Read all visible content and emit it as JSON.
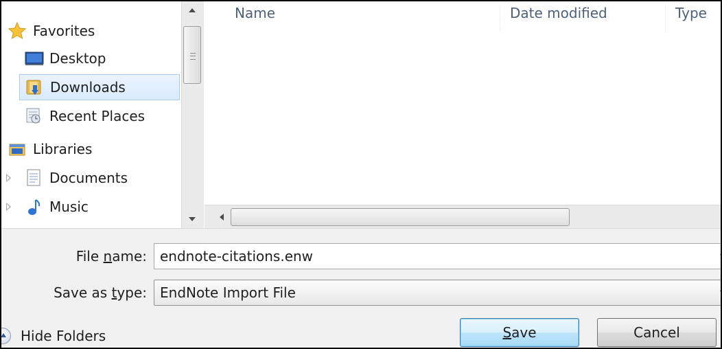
{
  "nav": {
    "favorites": {
      "label": "Favorites",
      "icon": "star-icon"
    },
    "items": [
      {
        "label": "Desktop",
        "icon": "desktop-icon",
        "selected": false
      },
      {
        "label": "Downloads",
        "icon": "downloads-folder-icon",
        "selected": true
      },
      {
        "label": "Recent Places",
        "icon": "recent-places-icon",
        "selected": false
      }
    ],
    "libraries": {
      "label": "Libraries",
      "icon": "libraries-icon"
    },
    "library_items": [
      {
        "label": "Documents",
        "icon": "documents-icon"
      },
      {
        "label": "Music",
        "icon": "music-note-icon"
      }
    ]
  },
  "file_list": {
    "columns": [
      "Name",
      "Date modified",
      "Type"
    ],
    "rows": []
  },
  "form": {
    "file_name_label_pre": "File ",
    "file_name_label_access": "n",
    "file_name_label_post": "ame:",
    "file_name_value": "endnote-citations.enw",
    "save_type_label_pre": "Save as ",
    "save_type_label_access": "t",
    "save_type_label_post": "ype:",
    "save_type_value": "EndNote Import File"
  },
  "footer": {
    "hide_folders_label": "Hide Folders",
    "save_access": "S",
    "save_rest": "ave",
    "cancel_label": "Cancel"
  },
  "colors": {
    "selected_bg": "#d9eafb",
    "selected_border": "#a9cdf1",
    "column_header_text": "#4c607a",
    "panel_bg": "#f0f0f0"
  }
}
